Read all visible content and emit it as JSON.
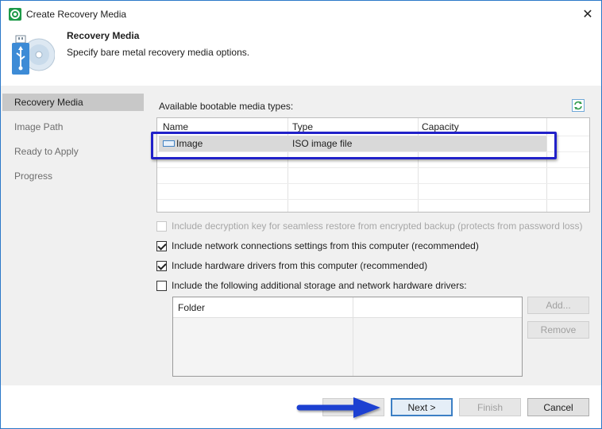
{
  "window": {
    "title": "Create Recovery Media",
    "close_glyph": "✕"
  },
  "header": {
    "title": "Recovery Media",
    "subtitle": "Specify bare metal recovery media options.",
    "icon": "usb-disc-icon"
  },
  "nav": {
    "items": [
      {
        "label": "Recovery Media",
        "selected": true
      },
      {
        "label": "Image Path",
        "selected": false
      },
      {
        "label": "Ready to Apply",
        "selected": false
      },
      {
        "label": "Progress",
        "selected": false
      }
    ]
  },
  "content": {
    "available_label": "Available bootable media types:",
    "media_table": {
      "columns": [
        "Name",
        "Type",
        "Capacity"
      ],
      "rows": [
        {
          "name": "Image",
          "type": "ISO image file",
          "capacity": ""
        }
      ]
    },
    "options": [
      {
        "label": "Include decryption key for seamless restore from encrypted backup (protects from password loss)",
        "checked": false,
        "enabled": false
      },
      {
        "label": "Include network connections settings from this computer (recommended)",
        "checked": true,
        "enabled": true
      },
      {
        "label": "Include hardware drivers from this computer (recommended)",
        "checked": true,
        "enabled": true
      },
      {
        "label": "Include the following additional storage and network hardware drivers:",
        "checked": false,
        "enabled": true
      }
    ],
    "folder_table": {
      "columns": [
        "Folder",
        ""
      ]
    },
    "add_button": "Add...",
    "remove_button": "Remove"
  },
  "footer": {
    "previous_button": "",
    "next_button": "Next >",
    "finish_button": "Finish",
    "cancel_button": "Cancel"
  },
  "colors": {
    "highlight": "#2121c9",
    "arrow": "#1f3fd1",
    "accent": "#3c7fc4"
  }
}
